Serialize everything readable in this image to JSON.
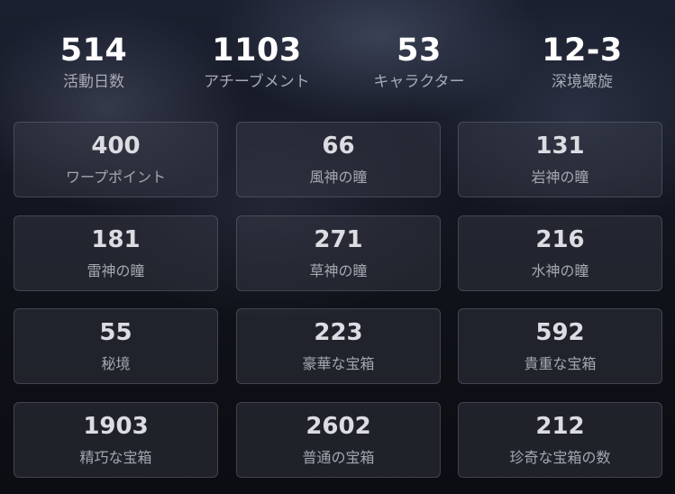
{
  "summary": [
    {
      "value": "514",
      "label": "活動日数"
    },
    {
      "value": "1103",
      "label": "アチーブメント"
    },
    {
      "value": "53",
      "label": "キャラクター"
    },
    {
      "value": "12-3",
      "label": "深境螺旋"
    }
  ],
  "tiles": [
    {
      "value": "400",
      "label": "ワープポイント"
    },
    {
      "value": "66",
      "label": "風神の瞳"
    },
    {
      "value": "131",
      "label": "岩神の瞳"
    },
    {
      "value": "181",
      "label": "雷神の瞳"
    },
    {
      "value": "271",
      "label": "草神の瞳"
    },
    {
      "value": "216",
      "label": "水神の瞳"
    },
    {
      "value": "55",
      "label": "秘境"
    },
    {
      "value": "223",
      "label": "豪華な宝箱"
    },
    {
      "value": "592",
      "label": "貴重な宝箱"
    },
    {
      "value": "1903",
      "label": "精巧な宝箱"
    },
    {
      "value": "2602",
      "label": "普通の宝箱"
    },
    {
      "value": "212",
      "label": "珍奇な宝箱の数"
    }
  ]
}
